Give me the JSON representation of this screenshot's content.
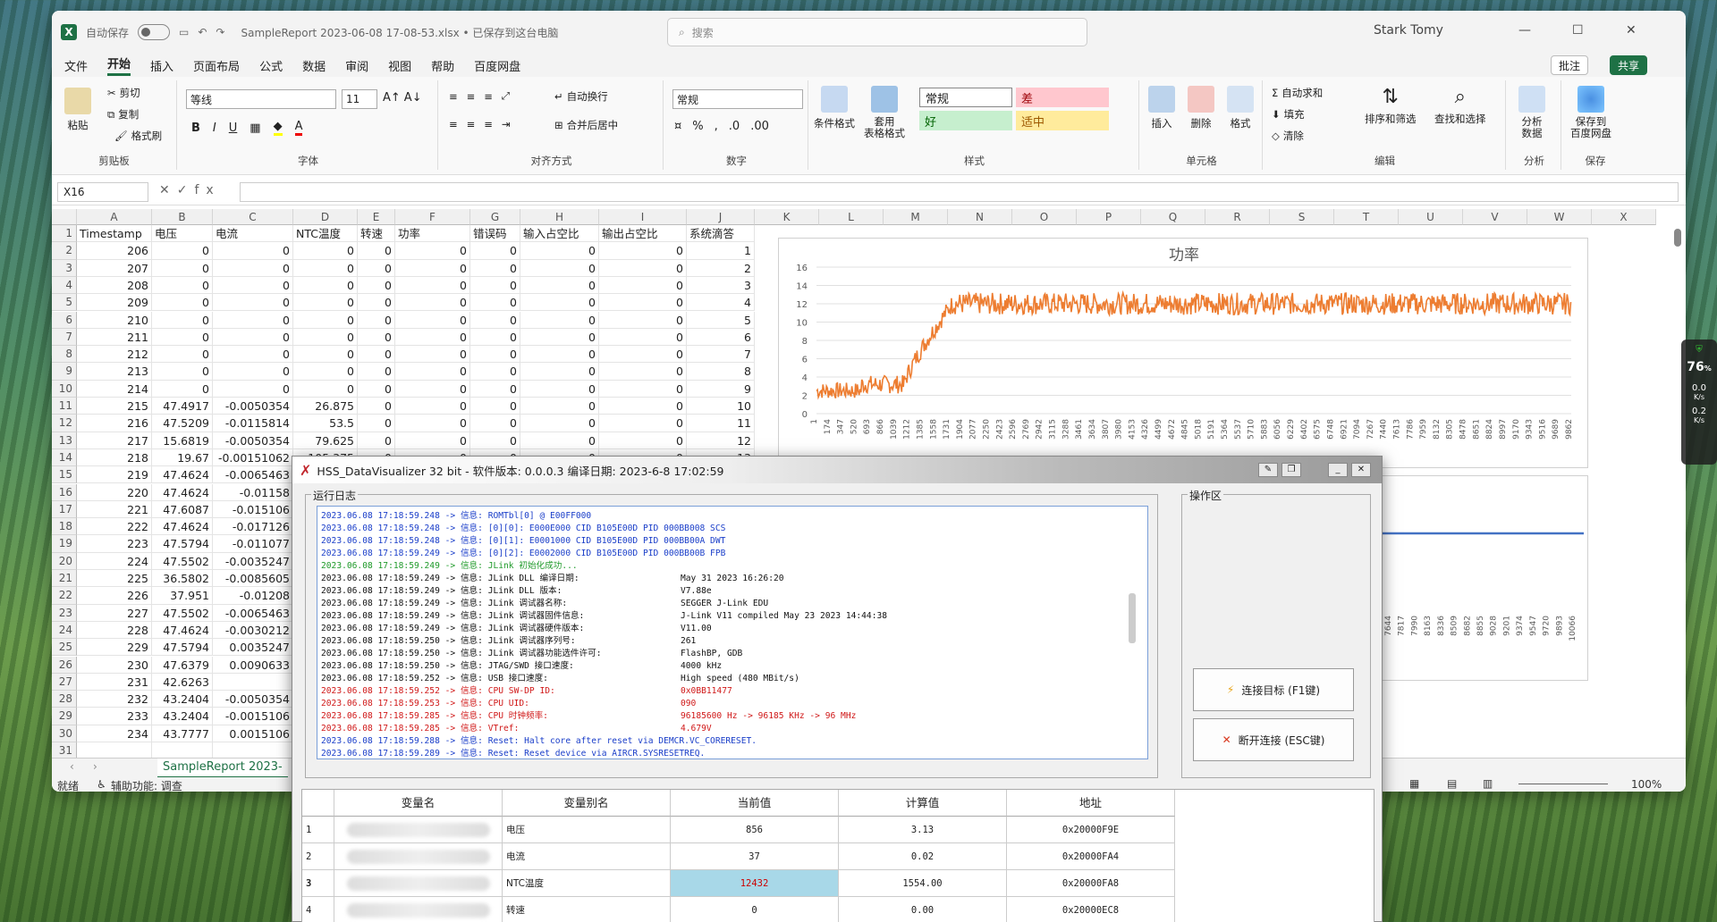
{
  "excel": {
    "title": "SampleReport 2023-06-08 17-08-53.xlsx • 已保存到这台电脑",
    "autosave": "自动保存",
    "search_placeholder": "搜索",
    "user": "Stark Tomy",
    "menu": [
      "文件",
      "开始",
      "插入",
      "页面布局",
      "公式",
      "数据",
      "审阅",
      "视图",
      "帮助",
      "百度网盘"
    ],
    "comment_btn": "批注",
    "share_btn": "共享",
    "ribbon": {
      "paste": "粘贴",
      "cut": "剪切",
      "copy": "复制",
      "format_painter": "格式刷",
      "clipboard": "剪贴板",
      "font_name": "等线",
      "font_size": "11",
      "font": "字体",
      "wrap": "自动换行",
      "merge": "合并后居中",
      "align": "对齐方式",
      "numfmt": "常规",
      "number": "数字",
      "cond_format": "条件格式",
      "table_format": "套用\n表格格式",
      "styles": "样式",
      "style_normal": "常规",
      "style_bad": "差",
      "style_good": "好",
      "style_neutral": "适中",
      "insert": "插入",
      "delete": "删除",
      "format": "格式",
      "cells": "单元格",
      "autosum": "自动求和",
      "fill": "填充",
      "clear": "清除",
      "sort": "排序和筛选",
      "find": "查找和选择",
      "edit": "编辑",
      "analyze": "分析\n数据",
      "analysis": "分析",
      "save_baidu": "保存到\n百度网盘",
      "save": "保存"
    },
    "namebox": "X16",
    "columns": [
      "A",
      "B",
      "C",
      "D",
      "E",
      "F",
      "G",
      "H",
      "I",
      "J",
      "K",
      "L",
      "M",
      "N",
      "O",
      "P",
      "Q",
      "R",
      "S",
      "T",
      "U",
      "V",
      "W",
      "X"
    ],
    "headers": [
      "Timestamp",
      "电压",
      "电流",
      "NTC温度",
      "转速",
      "功率",
      "错误码",
      "输入占空比",
      "输出占空比",
      "系统滴答"
    ],
    "rows": [
      [
        "206",
        "0",
        "0",
        "0",
        "0",
        "0",
        "0",
        "0",
        "0",
        "1"
      ],
      [
        "207",
        "0",
        "0",
        "0",
        "0",
        "0",
        "0",
        "0",
        "0",
        "2"
      ],
      [
        "208",
        "0",
        "0",
        "0",
        "0",
        "0",
        "0",
        "0",
        "0",
        "3"
      ],
      [
        "209",
        "0",
        "0",
        "0",
        "0",
        "0",
        "0",
        "0",
        "0",
        "4"
      ],
      [
        "210",
        "0",
        "0",
        "0",
        "0",
        "0",
        "0",
        "0",
        "0",
        "5"
      ],
      [
        "211",
        "0",
        "0",
        "0",
        "0",
        "0",
        "0",
        "0",
        "0",
        "6"
      ],
      [
        "212",
        "0",
        "0",
        "0",
        "0",
        "0",
        "0",
        "0",
        "0",
        "7"
      ],
      [
        "213",
        "0",
        "0",
        "0",
        "0",
        "0",
        "0",
        "0",
        "0",
        "8"
      ],
      [
        "214",
        "0",
        "0",
        "0",
        "0",
        "0",
        "0",
        "0",
        "0",
        "9"
      ],
      [
        "215",
        "47.4917",
        "-0.0050354",
        "26.875",
        "0",
        "0",
        "0",
        "0",
        "0",
        "10"
      ],
      [
        "216",
        "47.5209",
        "-0.0115814",
        "53.5",
        "0",
        "0",
        "0",
        "0",
        "0",
        "11"
      ],
      [
        "217",
        "15.6819",
        "-0.0050354",
        "79.625",
        "0",
        "0",
        "0",
        "0",
        "0",
        "12"
      ],
      [
        "218",
        "19.67",
        "-0.00151062",
        "105.375",
        "0",
        "0",
        "0",
        "0",
        "0",
        "13"
      ],
      [
        "219",
        "47.4624",
        "-0.0065463",
        "",
        "",
        "",
        "",
        "",
        "",
        ""
      ],
      [
        "220",
        "47.4624",
        "-0.01158",
        "",
        "",
        "",
        "",
        "",
        "",
        ""
      ],
      [
        "221",
        "47.6087",
        "-0.015106",
        "",
        "",
        "",
        "",
        "",
        "",
        ""
      ],
      [
        "222",
        "47.4624",
        "-0.017126",
        "",
        "",
        "",
        "",
        "",
        "",
        ""
      ],
      [
        "223",
        "47.5794",
        "-0.011077",
        "",
        "",
        "",
        "",
        "",
        "",
        ""
      ],
      [
        "224",
        "47.5502",
        "-0.0035247",
        "",
        "",
        "",
        "",
        "",
        "",
        ""
      ],
      [
        "225",
        "36.5802",
        "-0.0085605",
        "",
        "",
        "",
        "",
        "",
        "",
        ""
      ],
      [
        "226",
        "37.951",
        "-0.01208",
        "",
        "",
        "",
        "",
        "",
        "",
        ""
      ],
      [
        "227",
        "47.5502",
        "-0.0065463",
        "",
        "",
        "",
        "",
        "",
        "",
        ""
      ],
      [
        "228",
        "47.4624",
        "-0.0030212",
        "",
        "",
        "",
        "",
        "",
        "",
        ""
      ],
      [
        "229",
        "47.5794",
        "0.0035247",
        "",
        "",
        "",
        "",
        "",
        "",
        ""
      ],
      [
        "230",
        "47.6379",
        "0.0090633",
        "",
        "",
        "",
        "",
        "",
        "",
        ""
      ],
      [
        "231",
        "42.6263",
        "",
        "",
        "",
        "",
        "",
        "",
        "",
        ""
      ],
      [
        "232",
        "43.2404",
        "-0.0050354",
        "",
        "",
        "",
        "",
        "",
        "",
        ""
      ],
      [
        "233",
        "43.2404",
        "-0.0015106",
        "",
        "",
        "",
        "",
        "",
        "",
        ""
      ],
      [
        "234",
        "43.7777",
        "0.0015106",
        "",
        "",
        "",
        "",
        "",
        "",
        ""
      ]
    ],
    "sheet_tab": "SampleReport 2023-",
    "status_ready": "就绪",
    "status_access": "辅助功能: 调查",
    "zoom": "100%"
  },
  "chart_data": [
    {
      "type": "line",
      "title": "功率",
      "xlabel": "",
      "ylabel": "",
      "ylim": [
        0,
        16
      ],
      "yticks": [
        0,
        2,
        4,
        6,
        8,
        10,
        12,
        14,
        16
      ],
      "xticks": [
        "1",
        "174",
        "347",
        "520",
        "693",
        "866",
        "1039",
        "1212",
        "1385",
        "1558",
        "1731",
        "1904",
        "2077",
        "2250",
        "2423",
        "2596",
        "2769",
        "2942",
        "3115",
        "3288",
        "3461",
        "3634",
        "3807",
        "3980",
        "4153",
        "4326",
        "4499",
        "4672",
        "4845",
        "5018",
        "5191",
        "5364",
        "5537",
        "5710",
        "5883",
        "6056",
        "6229",
        "6402",
        "6575",
        "6748",
        "6921",
        "7094",
        "7267",
        "7440",
        "7613",
        "7786",
        "7959",
        "8132",
        "8305",
        "8478",
        "8651",
        "8824",
        "8997",
        "9170",
        "9343",
        "9516",
        "9689",
        "9862"
      ],
      "series": [
        {
          "color": "#ed7d31",
          "segments": [
            {
              "x": [
                1,
                600
              ],
              "y_mean": 2.5,
              "y_noise": 0.9
            },
            {
              "x": [
                600,
                1150
              ],
              "y_mean": 3.2,
              "y_noise": 1.0
            },
            {
              "x": [
                1150,
                1800
              ],
              "y_from": 3,
              "y_to": 12
            },
            {
              "x": [
                1800,
                9990
              ],
              "y_mean": 12,
              "y_noise": 1.2
            }
          ]
        }
      ]
    },
    {
      "type": "line",
      "title": "",
      "series": [
        {
          "color": "#4472c4",
          "y_constant": "flat"
        }
      ],
      "xticks": [
        "7644",
        "7817",
        "7990",
        "8163",
        "8336",
        "8509",
        "8682",
        "8855",
        "9028",
        "9201",
        "9374",
        "9547",
        "9720",
        "9893",
        "10066"
      ]
    }
  ],
  "dialog": {
    "title": "HSS_DataVisualizer 32 bit - 软件版本: 0.0.0.3 编译日期: 2023-6-8 17:02:59",
    "log_label": "运行日志",
    "op_label": "操作区",
    "connect": "连接目标 (F1键)",
    "disconnect": "断开连接 (ESC键)",
    "log": [
      {
        "c": "lb",
        "t": "2023.06.08 17:18:59.248 -> 信息: ROMTbl[0] @ E00FF000",
        "v": ""
      },
      {
        "c": "lb",
        "t": "2023.06.08 17:18:59.248 -> 信息: [0][0]: E000E000 CID B105E00D PID 000BB008 SCS",
        "v": ""
      },
      {
        "c": "lb",
        "t": "2023.06.08 17:18:59.248 -> 信息: [0][1]: E0001000 CID B105E00D PID 000BB00A DWT",
        "v": ""
      },
      {
        "c": "lb",
        "t": "2023.06.08 17:18:59.249 -> 信息: [0][2]: E0002000 CID B105E00D PID 000BB00B FPB",
        "v": ""
      },
      {
        "c": "lg",
        "t": "2023.06.08 17:18:59.249 -> 信息: JLink 初始化成功...",
        "v": ""
      },
      {
        "c": "lk",
        "t": "2023.06.08 17:18:59.249 -> 信息: JLink DLL 编译日期:",
        "v": "May 31 2023 16:26:20"
      },
      {
        "c": "lk",
        "t": "2023.06.08 17:18:59.249 -> 信息: JLink DLL 版本:",
        "v": "V7.88e"
      },
      {
        "c": "lk",
        "t": "2023.06.08 17:18:59.249 -> 信息: JLink 调试器名称:",
        "v": "SEGGER J-Link EDU"
      },
      {
        "c": "lk",
        "t": "2023.06.08 17:18:59.249 -> 信息: JLink 调试器固件信息:",
        "v": "J-Link V11 compiled May 23 2023 14:44:38"
      },
      {
        "c": "lk",
        "t": "2023.06.08 17:18:59.249 -> 信息: JLink 调试器硬件版本:",
        "v": "V11.00"
      },
      {
        "c": "lk",
        "t": "2023.06.08 17:18:59.250 -> 信息: JLink 调试器序列号:",
        "v": "261"
      },
      {
        "c": "lk",
        "t": "2023.06.08 17:18:59.250 -> 信息: JLink 调试器功能选件许可:",
        "v": "FlashBP, GDB"
      },
      {
        "c": "lk",
        "t": "2023.06.08 17:18:59.250 -> 信息: JTAG/SWD 接口速度:",
        "v": "4000 kHz"
      },
      {
        "c": "lk",
        "t": "2023.06.08 17:18:59.252 -> 信息: USB 接口速度:",
        "v": "High speed (480 MBit/s)"
      },
      {
        "c": "lr",
        "t": "2023.06.08 17:18:59.252 -> 信息: CPU SW-DP ID:",
        "v": "0x0BB11477"
      },
      {
        "c": "lr",
        "t": "2023.06.08 17:18:59.253 -> 信息: CPU UID:",
        "v": "090"
      },
      {
        "c": "lr",
        "t": "2023.06.08 17:18:59.285 -> 信息: CPU 时钟频率:",
        "v": "96185600 Hz -> 96185 KHz -> 96 MHz"
      },
      {
        "c": "lr",
        "t": "2023.06.08 17:18:59.285 -> 信息: VTref:",
        "v": "4.679V"
      },
      {
        "c": "lb",
        "t": "2023.06.08 17:18:59.288 -> 信息: Reset: Halt core after reset via DEMCR.VC_CORERESET.",
        "v": ""
      },
      {
        "c": "lb",
        "t": "2023.06.08 17:18:59.289 -> 信息: Reset: Reset device via AIRCR.SYSRESETREQ.",
        "v": ""
      }
    ],
    "table_headers": [
      "",
      "变量名",
      "变量别名",
      "当前值",
      "计算值",
      "地址"
    ],
    "table_rows": [
      [
        "1",
        "",
        "电压",
        "856",
        "3.13",
        "0x20000F9E"
      ],
      [
        "2",
        "",
        "电流",
        "37",
        "0.02",
        "0x20000FA4"
      ],
      [
        "3",
        "",
        "NTC温度",
        "12432",
        "1554.00",
        "0x20000FA8"
      ],
      [
        "4",
        "",
        "转速",
        "0",
        "0.00",
        "0x20000EC8"
      ]
    ]
  },
  "widget": {
    "pct": "76",
    "unit": "%",
    "up": "0.0",
    "down": "0.2",
    "rate": "K/s"
  }
}
